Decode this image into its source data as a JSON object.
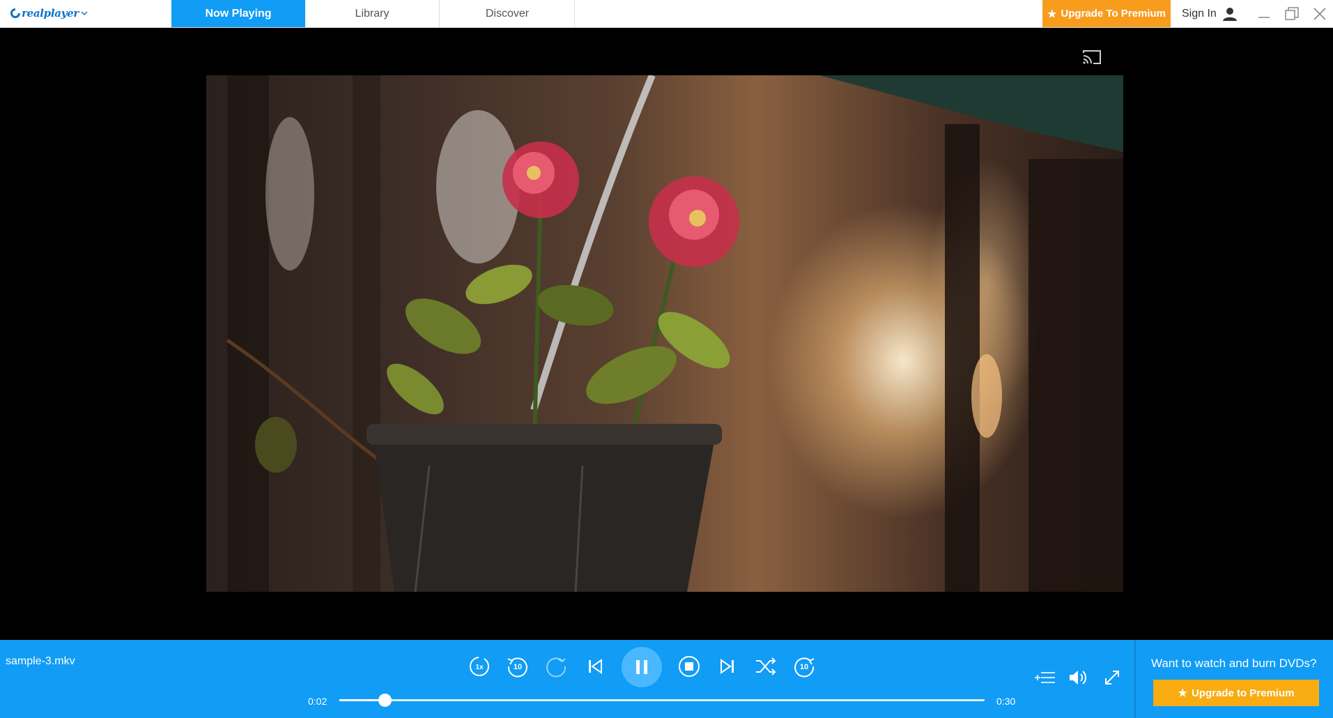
{
  "app": {
    "logo_text": "realplayer",
    "brand_color": "#119cf5",
    "accent_color": "#f89c1d"
  },
  "tabs": [
    {
      "label": "Now Playing",
      "active": true
    },
    {
      "label": "Library",
      "active": false
    },
    {
      "label": "Discover",
      "active": false
    }
  ],
  "header": {
    "upgrade_label": "Upgrade To Premium",
    "signin_label": "Sign In",
    "icons": [
      "star-icon",
      "user-icon",
      "minimize-icon",
      "restore-icon",
      "close-icon",
      "cast-icon"
    ]
  },
  "player": {
    "filename": "sample-3.mkv",
    "current_time": "0:02",
    "total_time": "0:30",
    "progress_fraction": 0.07,
    "playback_speed_label": "1x",
    "skip_seconds_label": "10",
    "state": "playing"
  },
  "promo": {
    "text": "Want to watch and burn DVDs?",
    "button_label": "Upgrade to Premium"
  }
}
